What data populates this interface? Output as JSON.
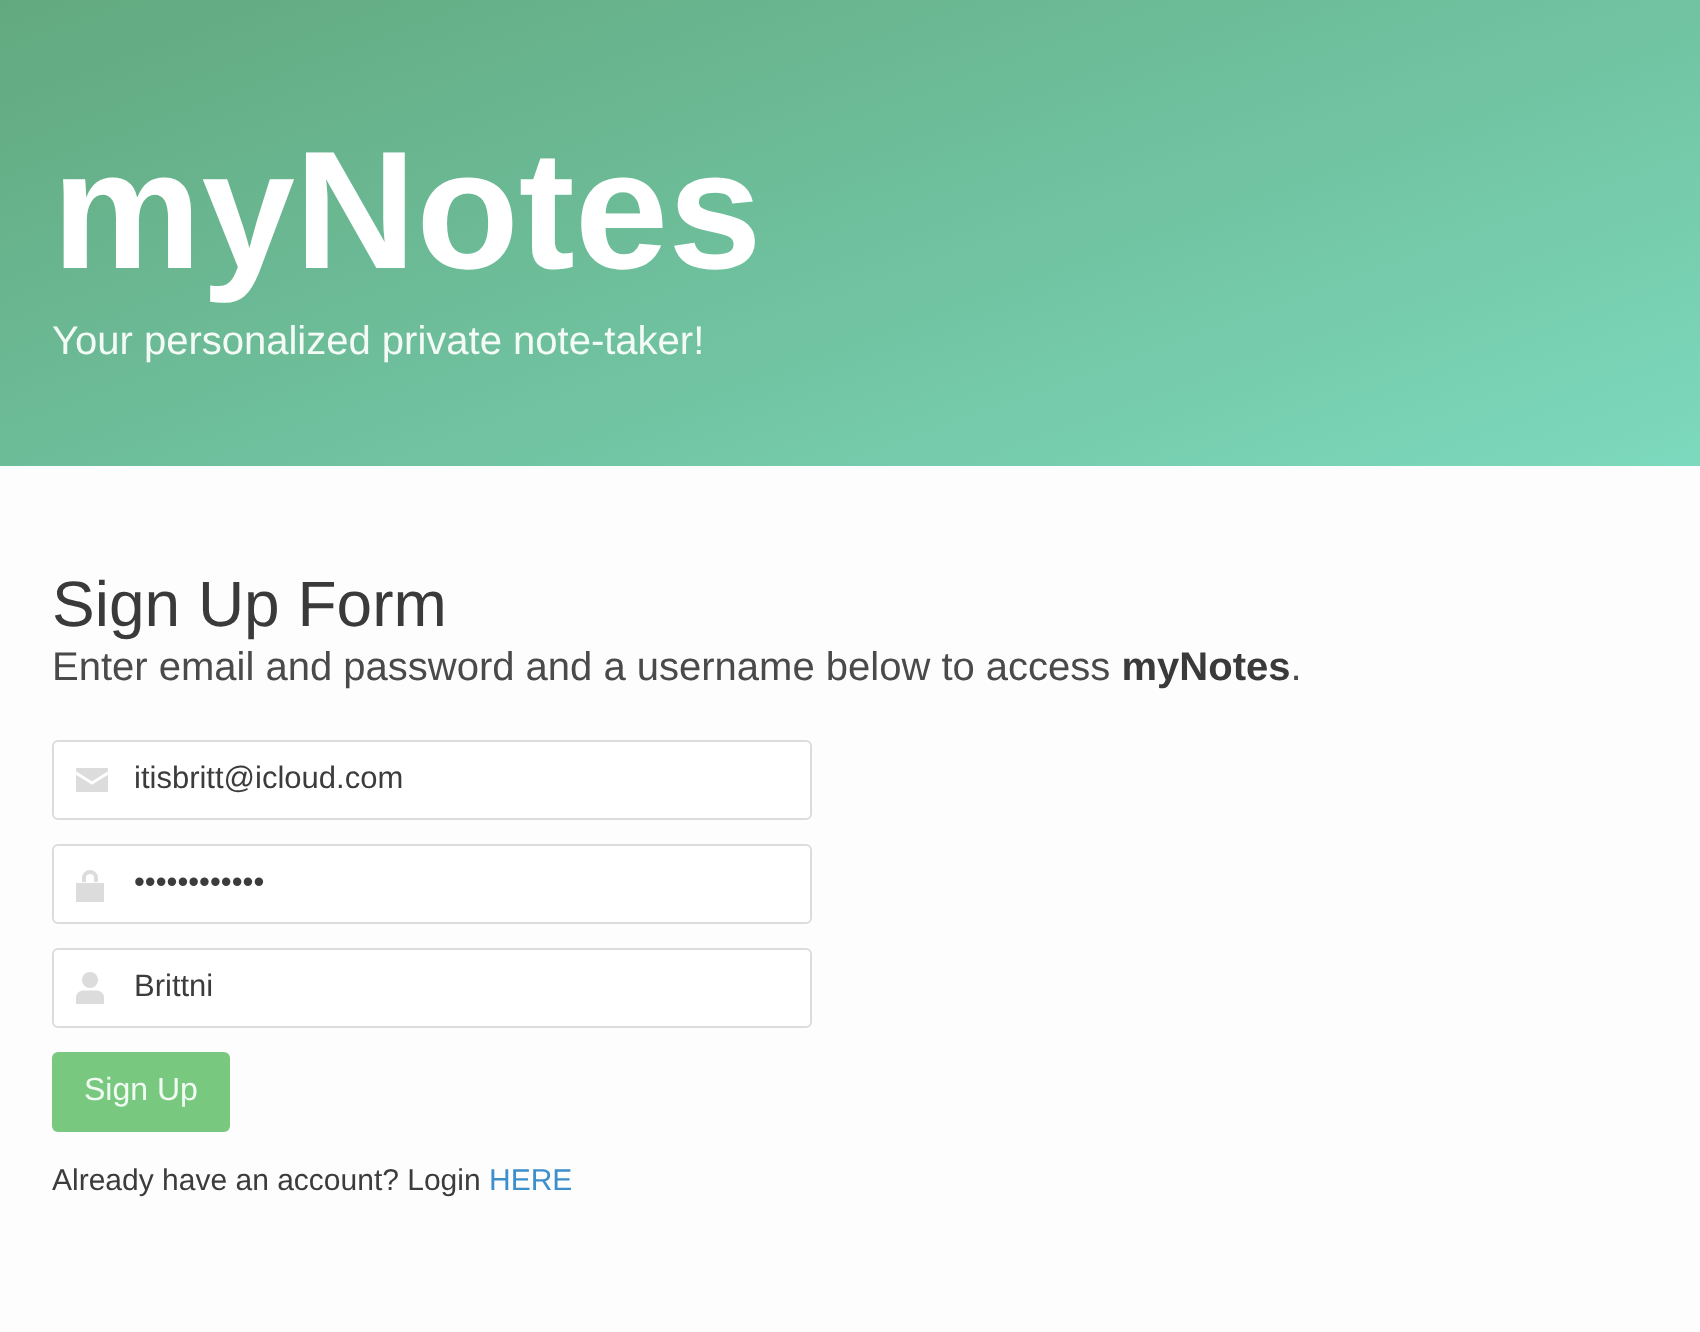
{
  "header": {
    "title": "myNotes",
    "tagline": "Your personalized private note-taker!"
  },
  "form": {
    "title": "Sign Up Form",
    "description": "Enter email and password and a username below to access **myNotes**.",
    "fields": [
      {
        "kind": "email",
        "value": "itisbritt@icloud.com"
      },
      {
        "kind": "password",
        "value": "••••••••••••"
      },
      {
        "kind": "username",
        "value": "Brittni"
      }
    ],
    "submit": "Sign Up",
    "login_prompt": {
      "text": "Already have an account? Login",
      "link": "HERE"
    }
  }
}
